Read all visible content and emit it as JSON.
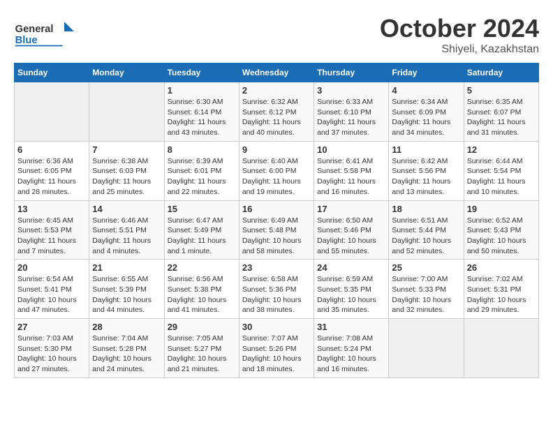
{
  "logo": {
    "general": "General",
    "blue": "Blue"
  },
  "header": {
    "month": "October 2024",
    "location": "Shiyeli, Kazakhstan"
  },
  "weekdays": [
    "Sunday",
    "Monday",
    "Tuesday",
    "Wednesday",
    "Thursday",
    "Friday",
    "Saturday"
  ],
  "weeks": [
    [
      {
        "day": "",
        "info": ""
      },
      {
        "day": "",
        "info": ""
      },
      {
        "day": "1",
        "sunrise": "6:30 AM",
        "sunset": "6:14 PM",
        "daylight": "11 hours and 43 minutes."
      },
      {
        "day": "2",
        "sunrise": "6:32 AM",
        "sunset": "6:12 PM",
        "daylight": "11 hours and 40 minutes."
      },
      {
        "day": "3",
        "sunrise": "6:33 AM",
        "sunset": "6:10 PM",
        "daylight": "11 hours and 37 minutes."
      },
      {
        "day": "4",
        "sunrise": "6:34 AM",
        "sunset": "6:09 PM",
        "daylight": "11 hours and 34 minutes."
      },
      {
        "day": "5",
        "sunrise": "6:35 AM",
        "sunset": "6:07 PM",
        "daylight": "11 hours and 31 minutes."
      }
    ],
    [
      {
        "day": "6",
        "sunrise": "6:36 AM",
        "sunset": "6:05 PM",
        "daylight": "11 hours and 28 minutes."
      },
      {
        "day": "7",
        "sunrise": "6:38 AM",
        "sunset": "6:03 PM",
        "daylight": "11 hours and 25 minutes."
      },
      {
        "day": "8",
        "sunrise": "6:39 AM",
        "sunset": "6:01 PM",
        "daylight": "11 hours and 22 minutes."
      },
      {
        "day": "9",
        "sunrise": "6:40 AM",
        "sunset": "6:00 PM",
        "daylight": "11 hours and 19 minutes."
      },
      {
        "day": "10",
        "sunrise": "6:41 AM",
        "sunset": "5:58 PM",
        "daylight": "11 hours and 16 minutes."
      },
      {
        "day": "11",
        "sunrise": "6:42 AM",
        "sunset": "5:56 PM",
        "daylight": "11 hours and 13 minutes."
      },
      {
        "day": "12",
        "sunrise": "6:44 AM",
        "sunset": "5:54 PM",
        "daylight": "11 hours and 10 minutes."
      }
    ],
    [
      {
        "day": "13",
        "sunrise": "6:45 AM",
        "sunset": "5:53 PM",
        "daylight": "11 hours and 7 minutes."
      },
      {
        "day": "14",
        "sunrise": "6:46 AM",
        "sunset": "5:51 PM",
        "daylight": "11 hours and 4 minutes."
      },
      {
        "day": "15",
        "sunrise": "6:47 AM",
        "sunset": "5:49 PM",
        "daylight": "11 hours and 1 minute."
      },
      {
        "day": "16",
        "sunrise": "6:49 AM",
        "sunset": "5:48 PM",
        "daylight": "10 hours and 58 minutes."
      },
      {
        "day": "17",
        "sunrise": "6:50 AM",
        "sunset": "5:46 PM",
        "daylight": "10 hours and 55 minutes."
      },
      {
        "day": "18",
        "sunrise": "6:51 AM",
        "sunset": "5:44 PM",
        "daylight": "10 hours and 52 minutes."
      },
      {
        "day": "19",
        "sunrise": "6:52 AM",
        "sunset": "5:43 PM",
        "daylight": "10 hours and 50 minutes."
      }
    ],
    [
      {
        "day": "20",
        "sunrise": "6:54 AM",
        "sunset": "5:41 PM",
        "daylight": "10 hours and 47 minutes."
      },
      {
        "day": "21",
        "sunrise": "6:55 AM",
        "sunset": "5:39 PM",
        "daylight": "10 hours and 44 minutes."
      },
      {
        "day": "22",
        "sunrise": "6:56 AM",
        "sunset": "5:38 PM",
        "daylight": "10 hours and 41 minutes."
      },
      {
        "day": "23",
        "sunrise": "6:58 AM",
        "sunset": "5:36 PM",
        "daylight": "10 hours and 38 minutes."
      },
      {
        "day": "24",
        "sunrise": "6:59 AM",
        "sunset": "5:35 PM",
        "daylight": "10 hours and 35 minutes."
      },
      {
        "day": "25",
        "sunrise": "7:00 AM",
        "sunset": "5:33 PM",
        "daylight": "10 hours and 32 minutes."
      },
      {
        "day": "26",
        "sunrise": "7:02 AM",
        "sunset": "5:31 PM",
        "daylight": "10 hours and 29 minutes."
      }
    ],
    [
      {
        "day": "27",
        "sunrise": "7:03 AM",
        "sunset": "5:30 PM",
        "daylight": "10 hours and 27 minutes."
      },
      {
        "day": "28",
        "sunrise": "7:04 AM",
        "sunset": "5:28 PM",
        "daylight": "10 hours and 24 minutes."
      },
      {
        "day": "29",
        "sunrise": "7:05 AM",
        "sunset": "5:27 PM",
        "daylight": "10 hours and 21 minutes."
      },
      {
        "day": "30",
        "sunrise": "7:07 AM",
        "sunset": "5:26 PM",
        "daylight": "10 hours and 18 minutes."
      },
      {
        "day": "31",
        "sunrise": "7:08 AM",
        "sunset": "5:24 PM",
        "daylight": "10 hours and 16 minutes."
      },
      {
        "day": "",
        "info": ""
      },
      {
        "day": "",
        "info": ""
      }
    ]
  ],
  "labels": {
    "sunrise": "Sunrise:",
    "sunset": "Sunset:",
    "daylight": "Daylight:"
  }
}
